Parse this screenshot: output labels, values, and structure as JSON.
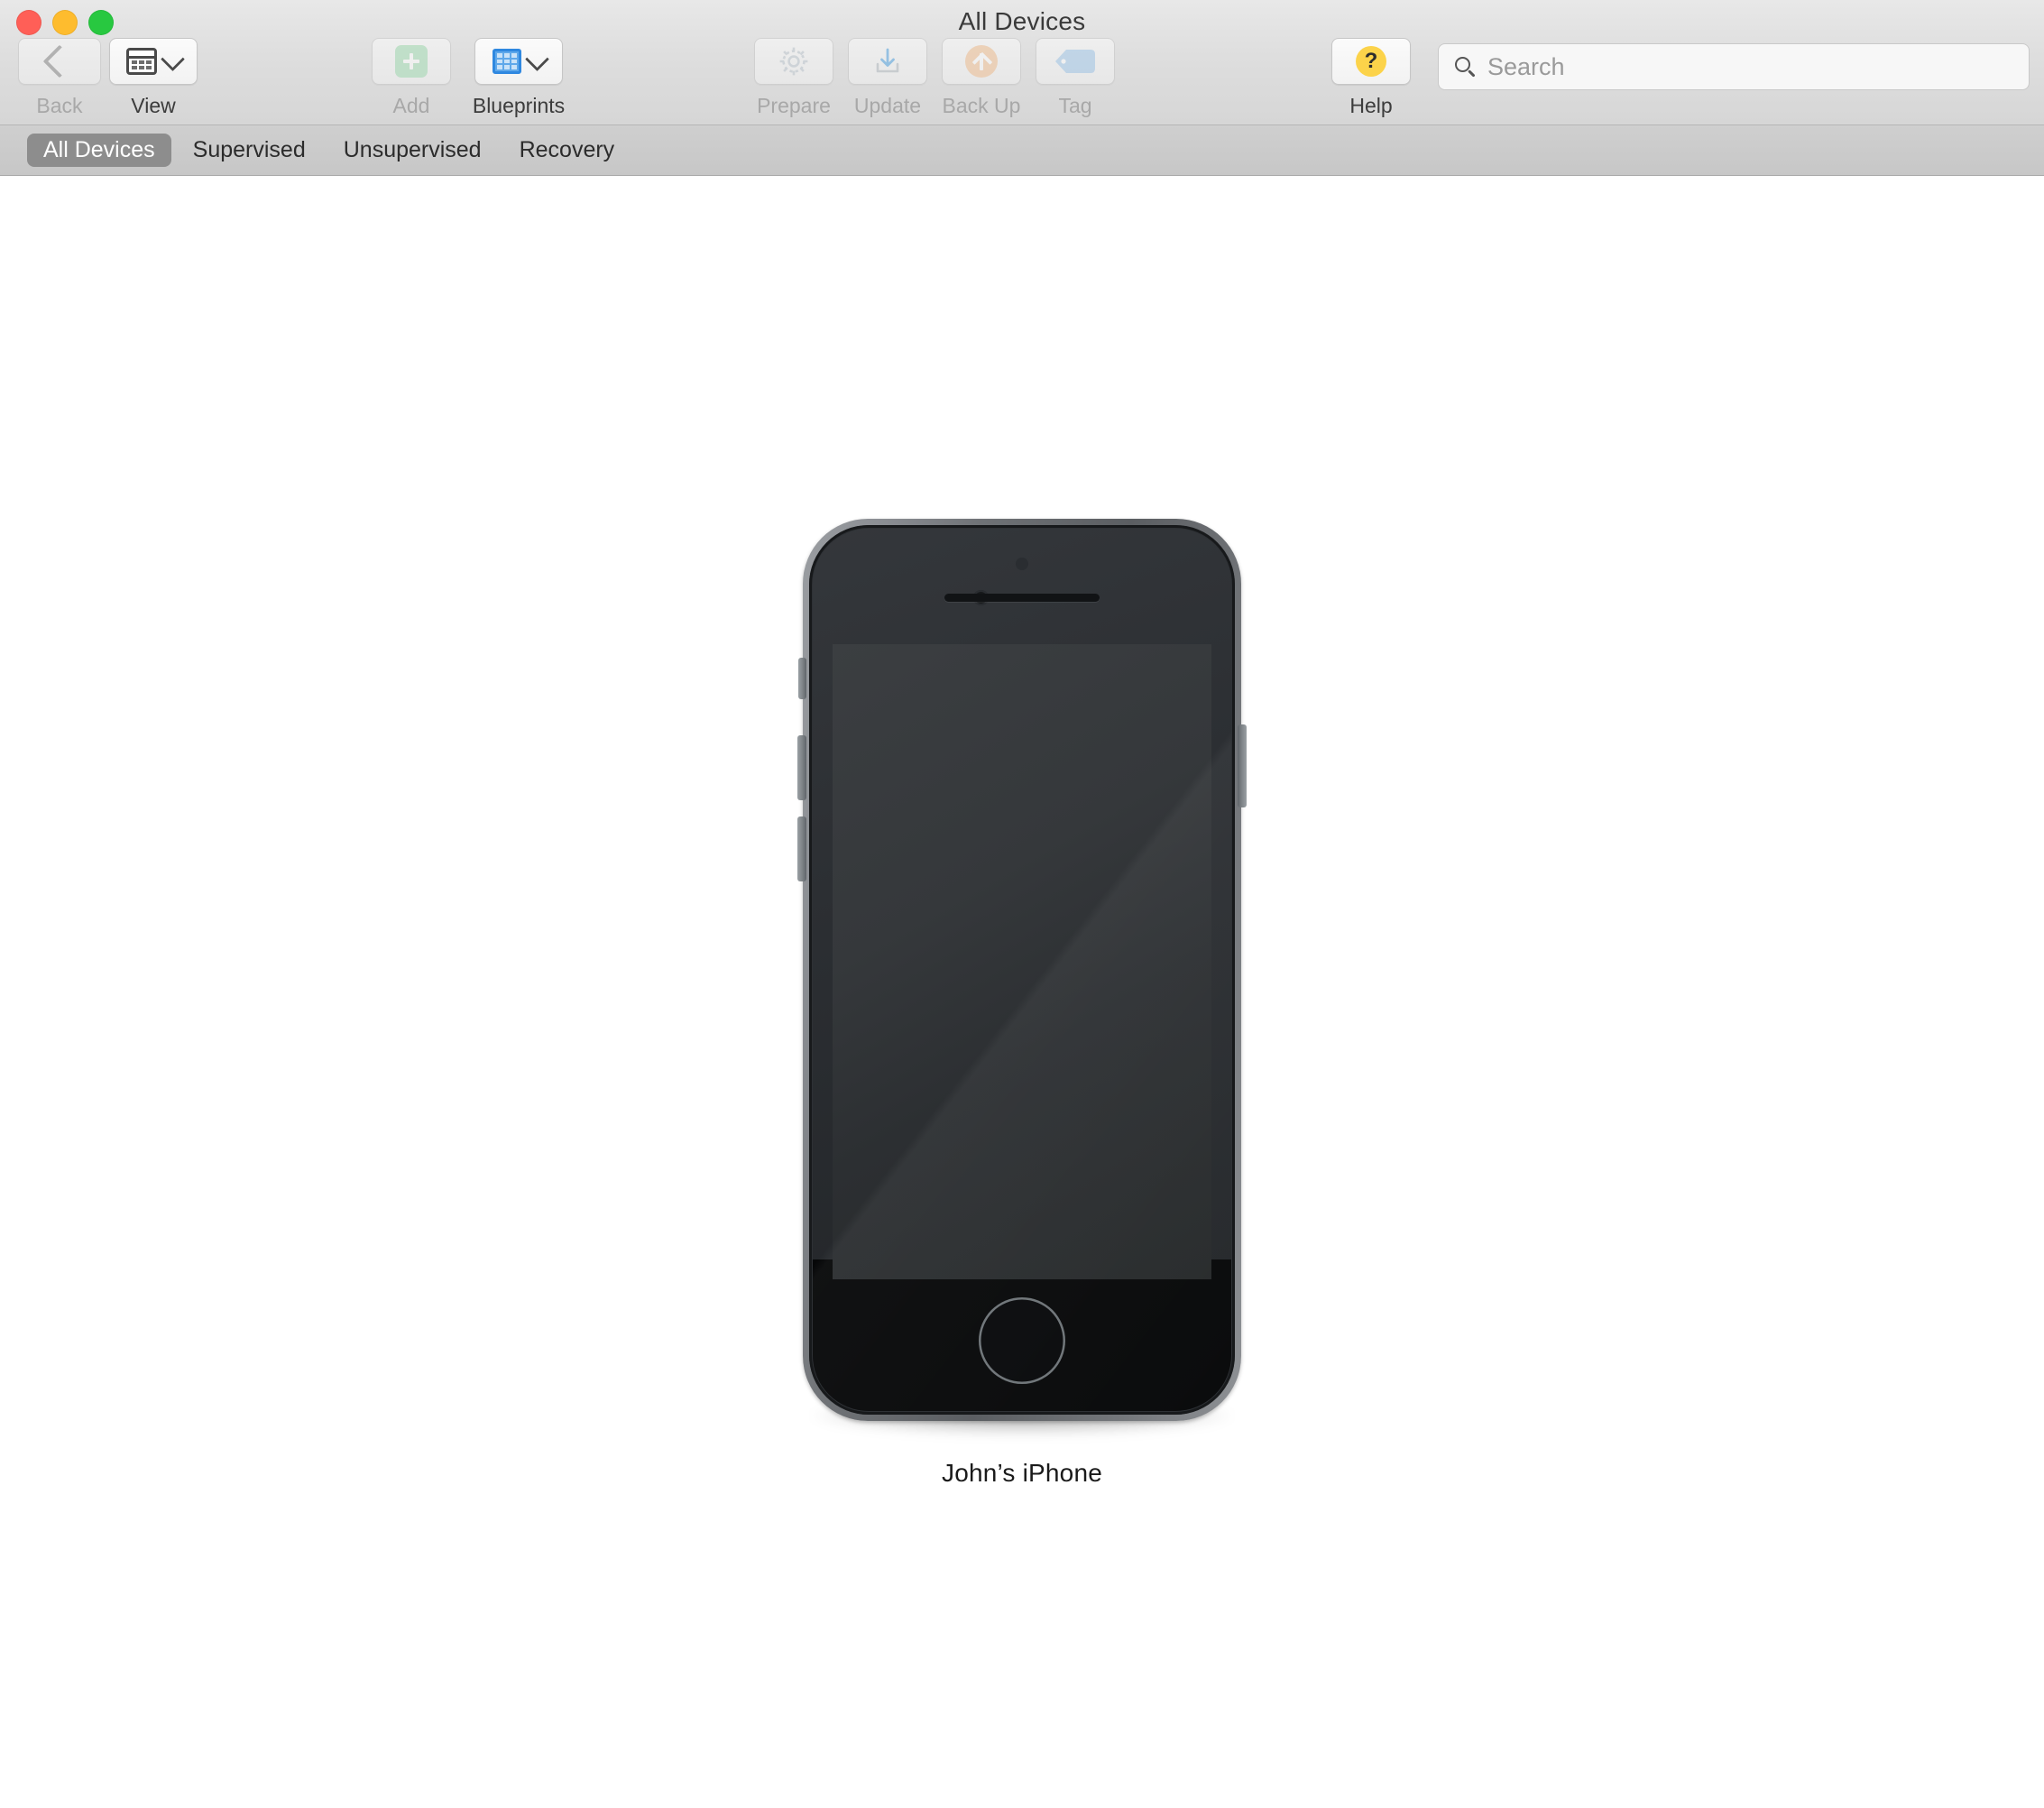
{
  "window": {
    "title": "All Devices",
    "traffic_lights": [
      {
        "name": "close",
        "color": "#ff5f57"
      },
      {
        "name": "minimize",
        "color": "#febc2e"
      },
      {
        "name": "maximize",
        "color": "#28c840"
      }
    ]
  },
  "toolbar": {
    "items": [
      {
        "id": "back",
        "label": "Back",
        "icon": "chevron-left-icon",
        "enabled": false
      },
      {
        "id": "view",
        "label": "View",
        "icon": "grid-window-icon",
        "enabled": true
      },
      {
        "id": "add",
        "label": "Add",
        "icon": "add-plus-icon",
        "enabled": false
      },
      {
        "id": "blueprints",
        "label": "Blueprints",
        "icon": "blueprint-grid-icon",
        "enabled": true
      },
      {
        "id": "prepare",
        "label": "Prepare",
        "icon": "gear-icon",
        "enabled": false
      },
      {
        "id": "update",
        "label": "Update",
        "icon": "download-tray-icon",
        "enabled": false
      },
      {
        "id": "backup",
        "label": "Back Up",
        "icon": "upload-circle-icon",
        "enabled": false
      },
      {
        "id": "tag",
        "label": "Tag",
        "icon": "tag-icon",
        "enabled": false
      },
      {
        "id": "help",
        "label": "Help",
        "icon": "help-question-icon",
        "enabled": true
      }
    ],
    "labels": {
      "back": "Back",
      "view": "View",
      "add": "Add",
      "blueprints": "Blueprints",
      "prepare": "Prepare",
      "update": "Update",
      "backup": "Back Up",
      "tag": "Tag",
      "help": "Help"
    },
    "colors": {
      "add_accent": "#a8e0b8",
      "blueprint_accent": "#3d92e5",
      "backup_accent": "#f6c69a",
      "tag_accent": "#a8cdee",
      "help_accent": "#fcd34a",
      "update_accent": "#5aa9e6"
    }
  },
  "search": {
    "placeholder": "Search",
    "value": "",
    "icon": "search-icon"
  },
  "tabs": {
    "selected": "All Devices",
    "items": [
      {
        "label": "All Devices",
        "active": true
      },
      {
        "label": "Supervised",
        "active": false
      },
      {
        "label": "Unsupervised",
        "active": false
      },
      {
        "label": "Recovery",
        "active": false
      }
    ]
  },
  "content": {
    "devices": [
      {
        "name": "John’s iPhone",
        "type": "iphone",
        "screen_state": "off",
        "body_color": "space-gray"
      }
    ]
  }
}
